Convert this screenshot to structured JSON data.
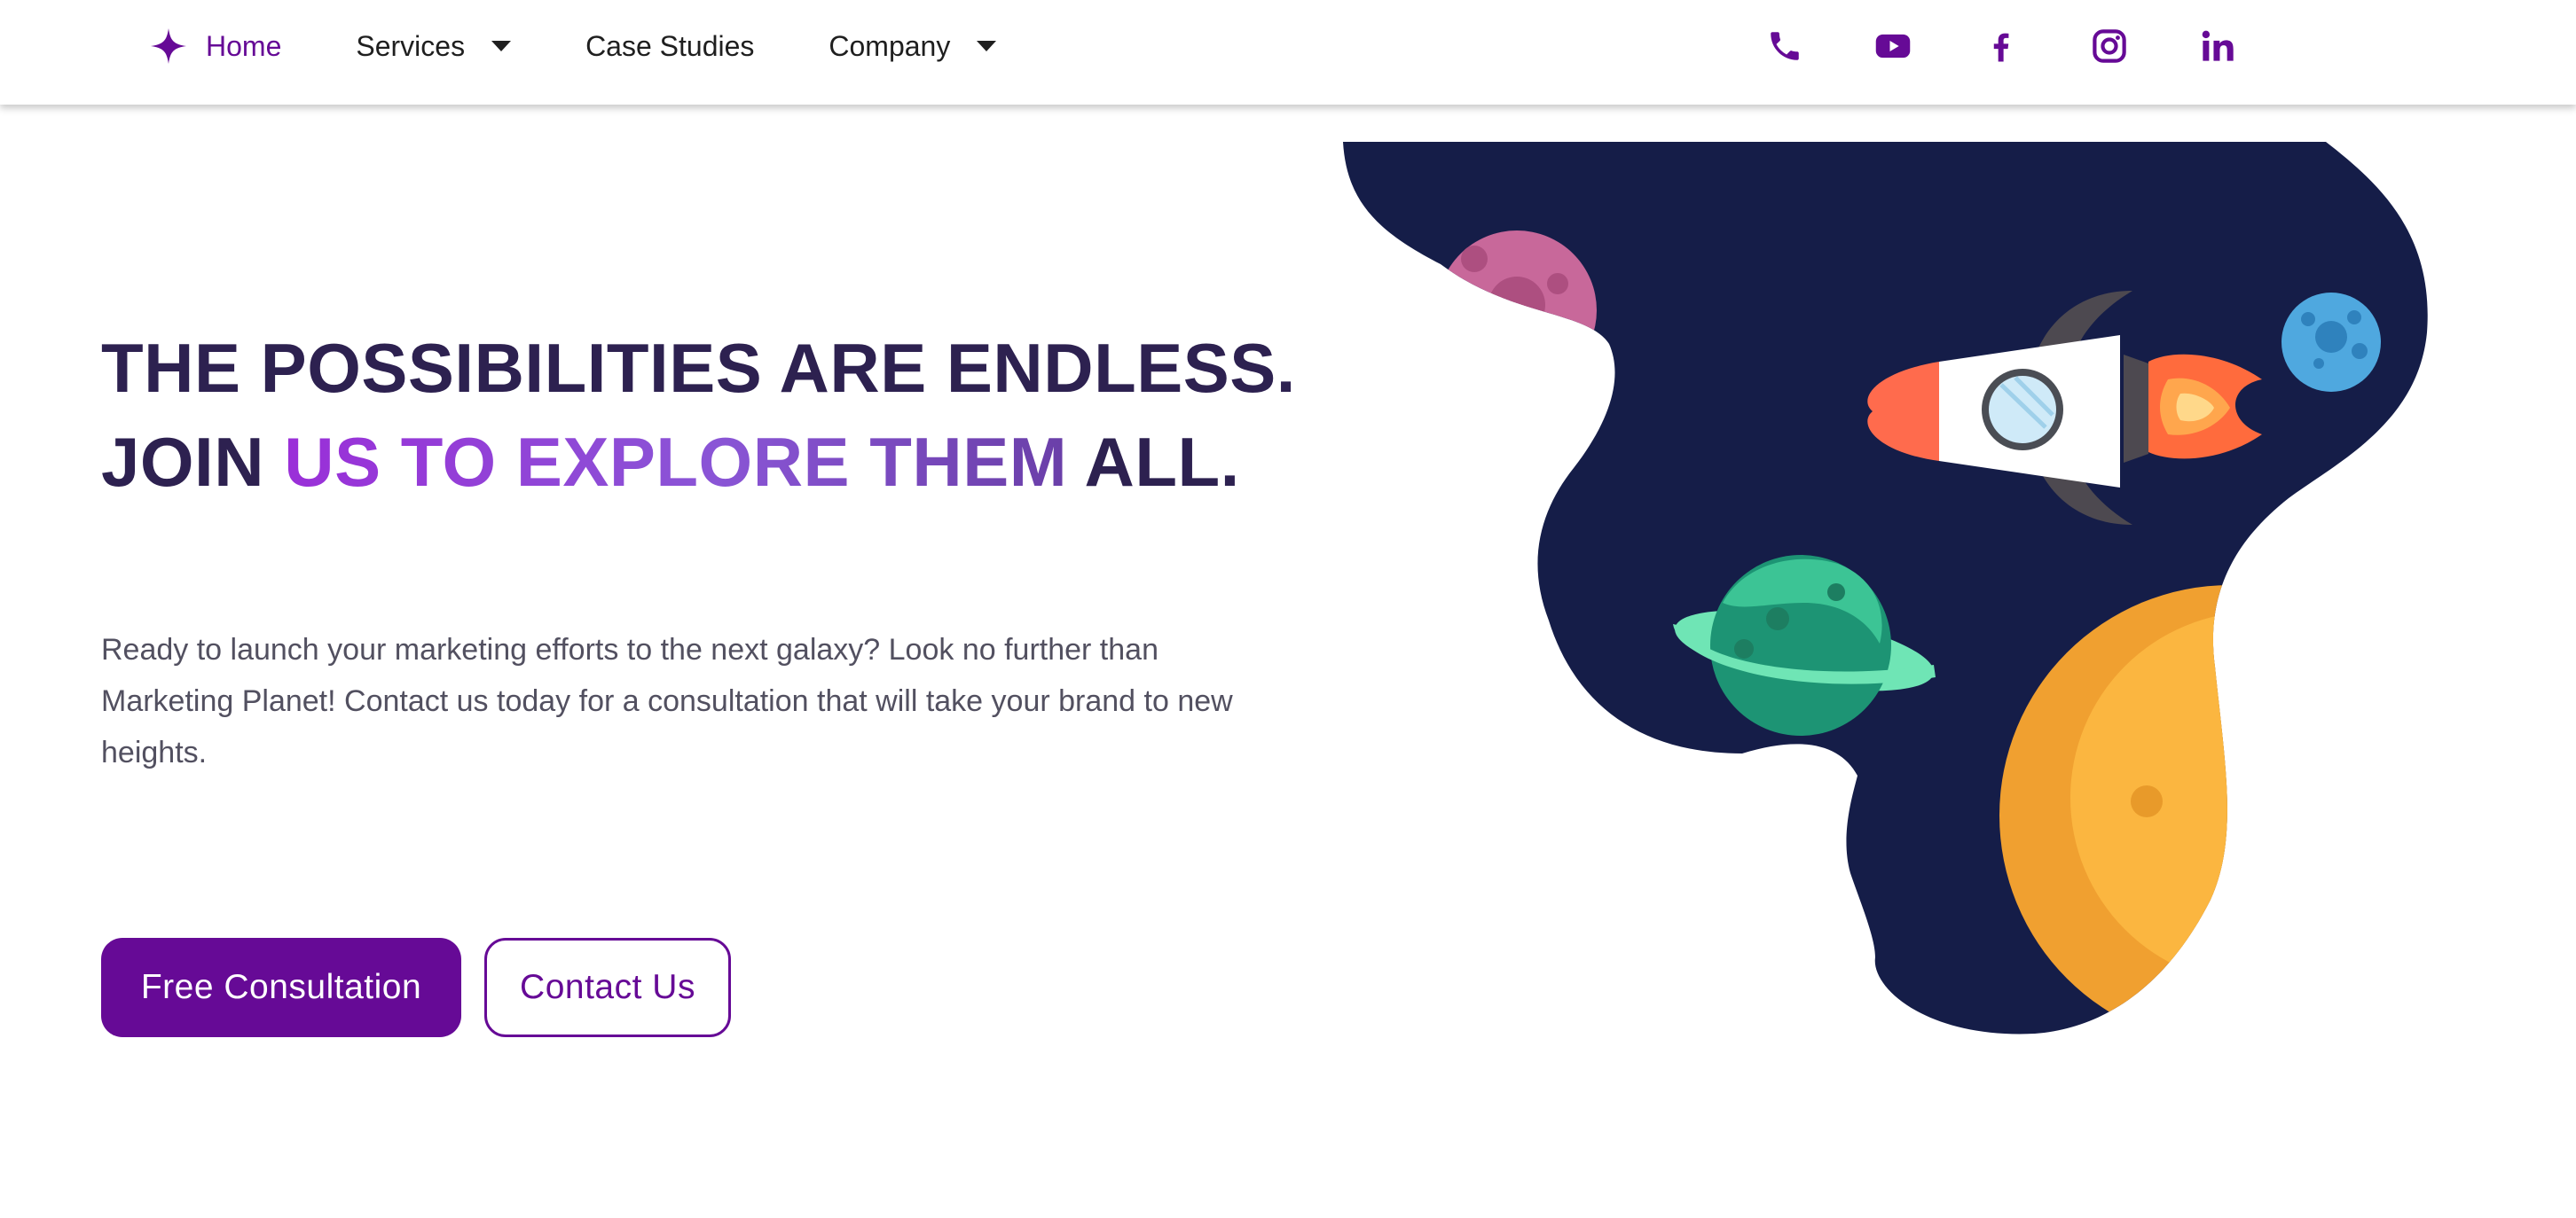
{
  "nav": {
    "items": [
      {
        "label": "Home",
        "active": true,
        "icon": "sparkle-star-icon"
      },
      {
        "label": "Services",
        "dropdown": true
      },
      {
        "label": "Case Studies"
      },
      {
        "label": "Company",
        "dropdown": true
      }
    ],
    "social": [
      "phone-icon",
      "youtube-icon",
      "facebook-icon",
      "instagram-icon",
      "linkedin-icon"
    ]
  },
  "hero": {
    "title_line1": "THE POSSIBILITIES ARE ENDLESS.",
    "title_line2_start": "JOIN ",
    "title_line2_highlight": "US TO EXPLORE THEM",
    "title_line2_end": " ALL.",
    "description": "Ready to launch your marketing efforts to the next galaxy? Look no further than Marketing Planet! Contact us today for a consultation that will take your brand to new heights.",
    "primary_button": "Free Consultation",
    "secondary_button": "Contact Us"
  },
  "colors": {
    "brand": "#660a96",
    "heading": "#2d2150",
    "space": "#151d48",
    "highlight_gradient": [
      "#9a2fd8",
      "#6a3fa8"
    ]
  }
}
